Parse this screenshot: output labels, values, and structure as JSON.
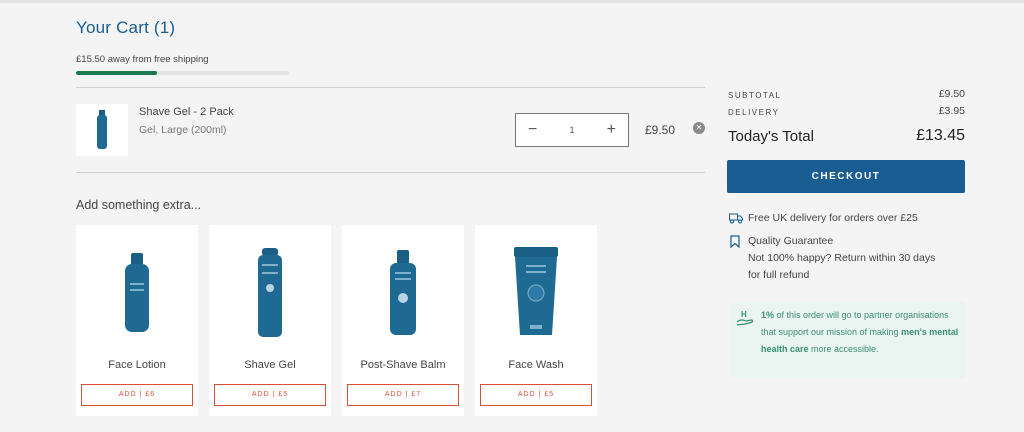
{
  "cart": {
    "title": "Your Cart (1)",
    "shipping_message": "£15.50 away from free shipping",
    "shipping_progress": 0.38
  },
  "line_item": {
    "name": "Shave Gel - 2 Pack",
    "variant": "Gel, Large (200ml)",
    "quantity": "1",
    "price": "£9.50",
    "minus_icon": "minus-icon",
    "plus_icon": "plus-icon",
    "remove_icon": "close-circle-icon"
  },
  "extras": {
    "title": "Add something extra...",
    "products": [
      {
        "name": "Face Lotion",
        "add_label": "ADD | £6"
      },
      {
        "name": "Shave Gel",
        "add_label": "ADD | £5"
      },
      {
        "name": "Post-Shave Balm",
        "add_label": "ADD | £7"
      },
      {
        "name": "Face Wash",
        "add_label": "ADD | £5"
      }
    ]
  },
  "summary": {
    "subtotal_label": "SUBTOTAL",
    "subtotal_value": "£9.50",
    "delivery_label": "DELIVERY",
    "delivery_value": "£3.95",
    "total_label": "Today's Total",
    "total_value": "£13.45",
    "checkout_label": "CHECKOUT"
  },
  "benefits": {
    "delivery": "Free UK delivery for orders over £25",
    "quality_title": "Quality Guarantee",
    "quality_line1": "Not 100% happy? Return within 30 days",
    "quality_line2": "for full refund"
  },
  "charity": {
    "pct": "1%",
    "text_a": " of this order will go to partner organisations that support our mission of making ",
    "highlight": "men's mental health care",
    "text_b": " more accessible."
  },
  "colors": {
    "brand_blue": "#1a5d92",
    "progress_green": "#1a7a4e",
    "add_red": "#d9503a",
    "charity_green": "#3a8f76"
  }
}
